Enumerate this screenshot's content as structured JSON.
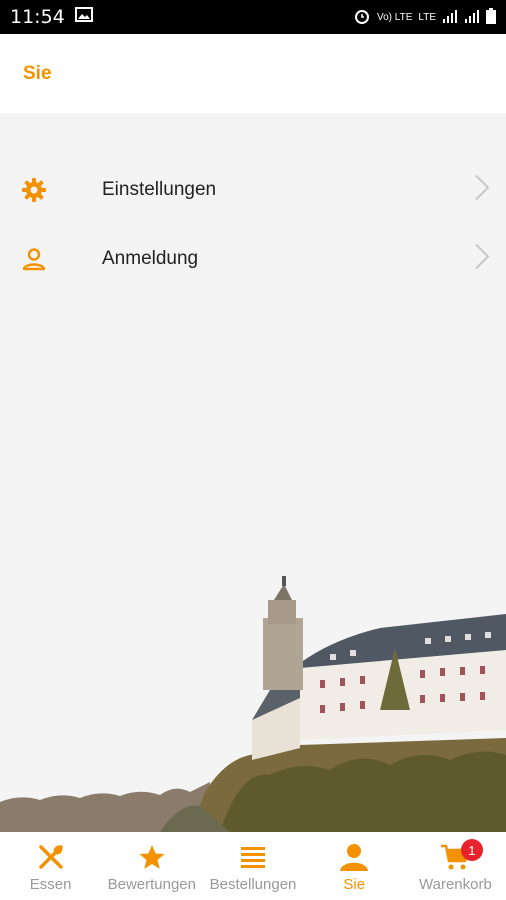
{
  "statusbar": {
    "time": "11:54",
    "volte": "Vo) LTE",
    "lte": "LTE"
  },
  "header": {
    "title": "Sie"
  },
  "menu": [
    {
      "label": "Einstellungen",
      "icon": "gear-icon"
    },
    {
      "label": "Anmeldung",
      "icon": "person-icon"
    }
  ],
  "tabs": [
    {
      "label": "Essen",
      "icon": "cutlery-icon"
    },
    {
      "label": "Bewertungen",
      "icon": "star-icon"
    },
    {
      "label": "Bestellungen",
      "icon": "list-icon"
    },
    {
      "label": "Sie",
      "icon": "user-icon",
      "active": true
    },
    {
      "label": "Warenkorb",
      "icon": "cart-icon",
      "badge": "1"
    }
  ],
  "colors": {
    "accent": "#f39200",
    "badge": "#e8232b",
    "inactive": "#999999"
  }
}
